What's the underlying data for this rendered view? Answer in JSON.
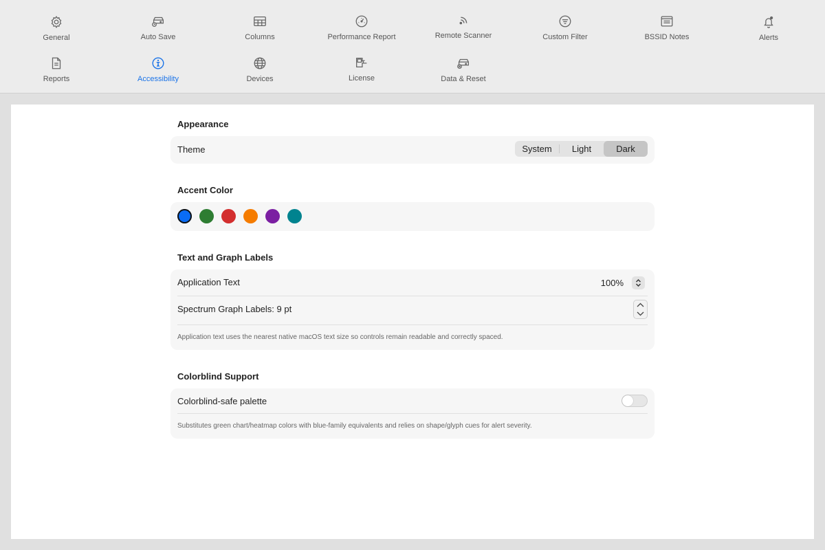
{
  "toolbar": {
    "items": [
      {
        "label": "General",
        "icon": "gear-icon"
      },
      {
        "label": "Auto Save",
        "icon": "history-drive-icon"
      },
      {
        "label": "Columns",
        "icon": "columns-icon"
      },
      {
        "label": "Performance Report",
        "icon": "gauge-icon"
      },
      {
        "label": "Remote Scanner",
        "icon": "wireless-icon"
      },
      {
        "label": "Custom Filter",
        "icon": "filter-icon"
      },
      {
        "label": "BSSID Notes",
        "icon": "notes-window-icon"
      },
      {
        "label": "Alerts",
        "icon": "bell-badge-icon"
      },
      {
        "label": "Reports",
        "icon": "document-icon"
      },
      {
        "label": "Accessibility",
        "icon": "accessibility-icon",
        "active": true
      },
      {
        "label": "Devices",
        "icon": "globe-icon"
      },
      {
        "label": "License",
        "icon": "license-key-icon"
      },
      {
        "label": "Data & Reset",
        "icon": "drive-reset-icon"
      }
    ],
    "active_color": "#1a73e8"
  },
  "appearance": {
    "title": "Appearance",
    "theme_label": "Theme",
    "options": [
      "System",
      "Light",
      "Dark"
    ],
    "selected": "Dark"
  },
  "accent": {
    "title": "Accent Color",
    "colors": [
      "#0a6cf5",
      "#2e7d32",
      "#d32f2f",
      "#f57c00",
      "#7b1fa2",
      "#00838f"
    ],
    "selected_index": 0
  },
  "labels": {
    "title": "Text and Graph Labels",
    "app_text_label": "Application Text",
    "app_text_value": "100%",
    "graph_label": "Spectrum Graph Labels: 9 pt",
    "note": "Application text uses the nearest native macOS text size so controls remain readable and correctly spaced."
  },
  "colorblind": {
    "title": "Colorblind Support",
    "palette_label": "Colorblind-safe palette",
    "palette_enabled": false,
    "note": "Substitutes green chart/heatmap colors with blue-family equivalents and relies on shape/glyph cues for alert severity."
  }
}
